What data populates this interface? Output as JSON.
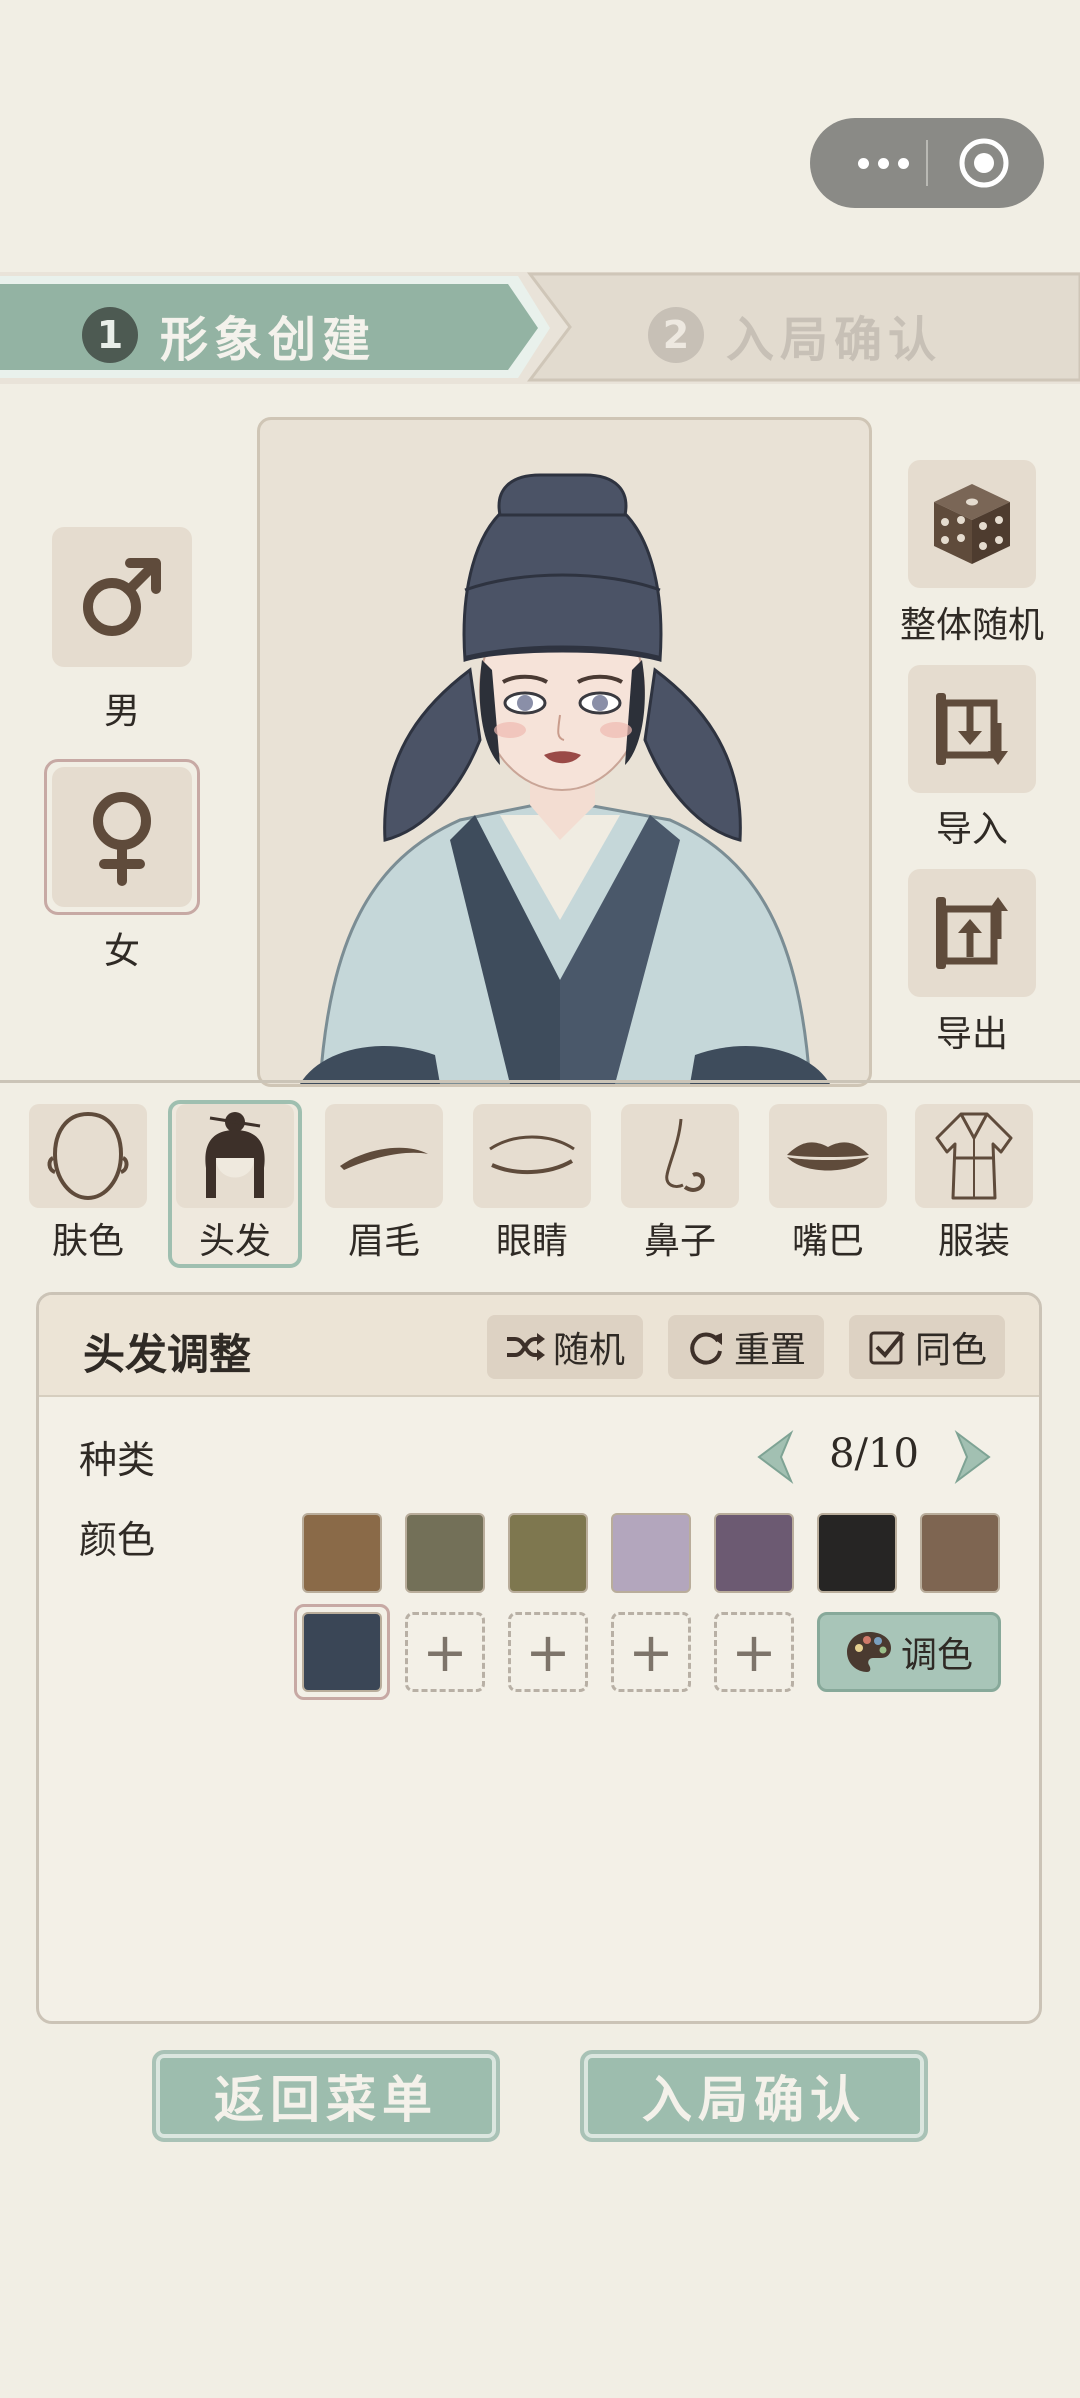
{
  "steps": [
    {
      "number": "1",
      "label": "形象创建",
      "active": true
    },
    {
      "number": "2",
      "label": "入局确认",
      "active": false
    }
  ],
  "gender": {
    "male_label": "男",
    "female_label": "女",
    "selected": "女"
  },
  "actions": {
    "random_all_label": "整体随机",
    "import_label": "导入",
    "export_label": "导出"
  },
  "categories": [
    {
      "label": "肤色",
      "icon": "face-outline-icon"
    },
    {
      "label": "头发",
      "icon": "hair-bun-icon"
    },
    {
      "label": "眉毛",
      "icon": "eyebrow-icon"
    },
    {
      "label": "眼睛",
      "icon": "eye-icon"
    },
    {
      "label": "鼻子",
      "icon": "nose-icon"
    },
    {
      "label": "嘴巴",
      "icon": "lips-icon"
    },
    {
      "label": "服装",
      "icon": "robe-icon"
    }
  ],
  "selected_category": "头发",
  "panel": {
    "title": "头发调整",
    "random_label": "随机",
    "reset_label": "重置",
    "same_color_label": "同色",
    "same_color_checked": true,
    "type_label": "种类",
    "type_counter": "8/10",
    "color_label": "颜色",
    "swatches": [
      "#8a6a48",
      "#737058",
      "#7e774f",
      "#b3a6bd",
      "#6c5a72",
      "#262524",
      "#7e6551",
      "#3a4656"
    ],
    "selected_swatch": "#3a4656",
    "palette_label": "调色"
  },
  "bottom": {
    "back_label": "返回菜单",
    "confirm_label": "入局确认"
  },
  "colors": {
    "background": "#f1eee4",
    "accent_green": "#9dbdae",
    "active_step": "#93b3a3"
  }
}
